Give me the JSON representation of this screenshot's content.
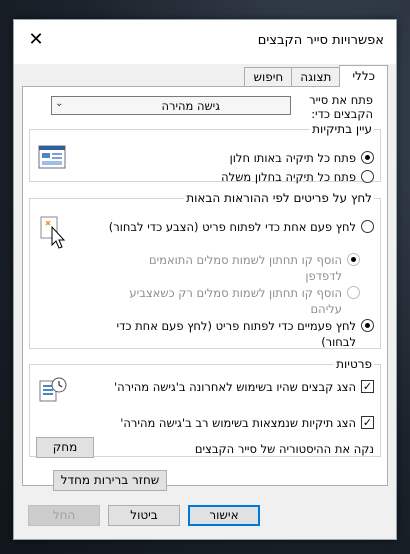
{
  "window": {
    "title": "אפשרויות סייר הקבצים",
    "close_glyph": "✕"
  },
  "tabs": [
    {
      "label": "כללי",
      "active": true
    },
    {
      "label": "תצוגה",
      "active": false
    },
    {
      "label": "חיפוש",
      "active": false
    }
  ],
  "general": {
    "browse_to_label": "פתח את סייר הקבצים כדי:",
    "browse_to_value": "גישה מהירה",
    "browse_folders": {
      "legend": "עיין בתיקיות",
      "options": [
        {
          "label": "פתח כל תיקיה באותו חלון",
          "checked": true
        },
        {
          "label": "פתח כל תיקיה בחלון משלה",
          "checked": false
        }
      ]
    },
    "click_items": {
      "legend": "לחץ על פריטים לפי ההוראות הבאות",
      "options": [
        {
          "label": "לחץ פעם אחת כדי לפתוח פריט (הצבע כדי לבחור)",
          "checked": false,
          "disabled": false
        },
        {
          "label": "הוסף קו תחתון לשמות סמלים התואמים לדפדפן",
          "checked": true,
          "disabled": true
        },
        {
          "label": "הוסף קו תחתון לשמות סמלים רק כשאצביע עליהם",
          "checked": false,
          "disabled": true
        },
        {
          "label": "לחץ פעמיים כדי לפתוח פריט (לחץ פעם אחת כדי לבחור)",
          "checked": true,
          "disabled": false
        }
      ]
    },
    "privacy": {
      "legend": "פרטיות",
      "options": [
        {
          "label": "הצג קבצים שהיו בשימוש לאחרונה ב'גישה מהירה'",
          "checked": true
        },
        {
          "label": "הצג תיקיות שנמצאות בשימוש רב ב'גישה מהירה'",
          "checked": true
        }
      ],
      "clear_label": "נקה את ההיסטוריה של סייר הקבצים",
      "clear_button": "מחק"
    },
    "restore_defaults": "שחזר ברירות מחדל"
  },
  "footer": {
    "ok": "אישור",
    "cancel": "ביטול",
    "apply": "החל"
  },
  "colors": {
    "accent": "#0078d7"
  }
}
